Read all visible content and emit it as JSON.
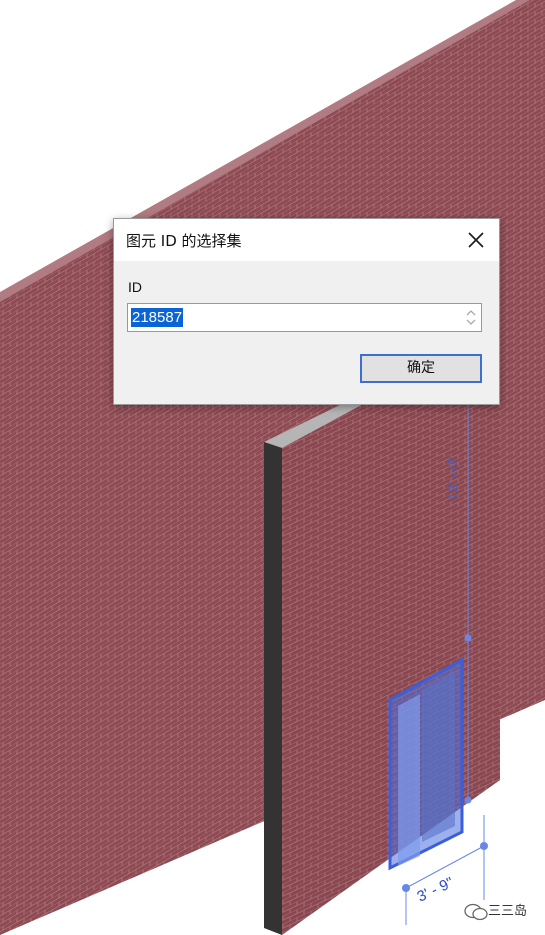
{
  "viewport": {
    "colors": {
      "brick": "#8e4a52",
      "mortar": "#b07b82",
      "wall_cap": "#b5b5b5",
      "wall_edge": "#333333",
      "selection": "#3b5fd9"
    },
    "dimensions": [
      "13' - 0\"",
      "3' - 9\""
    ]
  },
  "dialog": {
    "title": "图元 ID 的选择集",
    "close_icon": "close-icon",
    "id_label": "ID",
    "id_value": "218587",
    "ok_label": "确定"
  },
  "watermark": {
    "text": "三三岛",
    "icon": "wechat-icon"
  }
}
